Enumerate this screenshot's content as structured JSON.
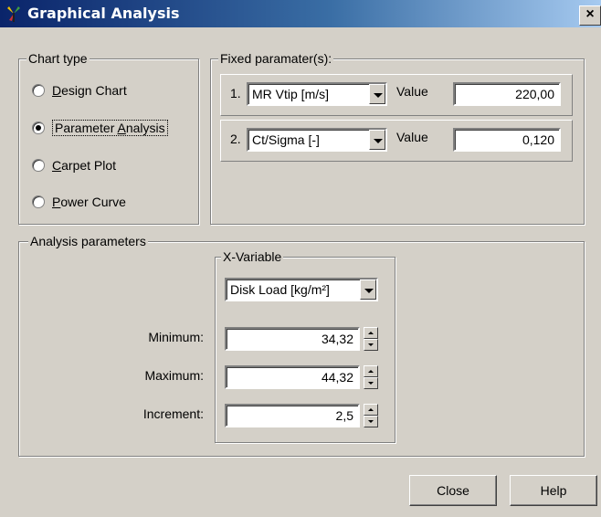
{
  "window": {
    "title": "Graphical Analysis",
    "close_glyph": "×"
  },
  "chart_type": {
    "legend": "Chart type",
    "options": [
      {
        "pre": "",
        "u": "D",
        "post": "esign Chart",
        "selected": false
      },
      {
        "pre": "Parameter ",
        "u": "A",
        "post": "nalysis",
        "selected": true
      },
      {
        "pre": "",
        "u": "C",
        "post": "arpet Plot",
        "selected": false
      },
      {
        "pre": "",
        "u": "P",
        "post": "ower Curve",
        "selected": false
      }
    ]
  },
  "fixed_params": {
    "legend": "Fixed paramater(s):",
    "rows": [
      {
        "index": "1.",
        "param": "MR Vtip [m/s]",
        "value_label": "Value",
        "value": "220,00"
      },
      {
        "index": "2.",
        "param": "Ct/Sigma [-]",
        "value_label": "Value",
        "value": "0,120"
      }
    ]
  },
  "analysis": {
    "legend": "Analysis parameters",
    "x_variable": {
      "legend": "X-Variable",
      "selected": "Disk Load [kg/m²]",
      "fields": [
        {
          "label": "Minimum:",
          "value": "34,32"
        },
        {
          "label": "Maximum:",
          "value": "44,32"
        },
        {
          "label": "Increment:",
          "value": "2,5"
        }
      ]
    }
  },
  "buttons": {
    "close": "Close",
    "help": "Help"
  }
}
